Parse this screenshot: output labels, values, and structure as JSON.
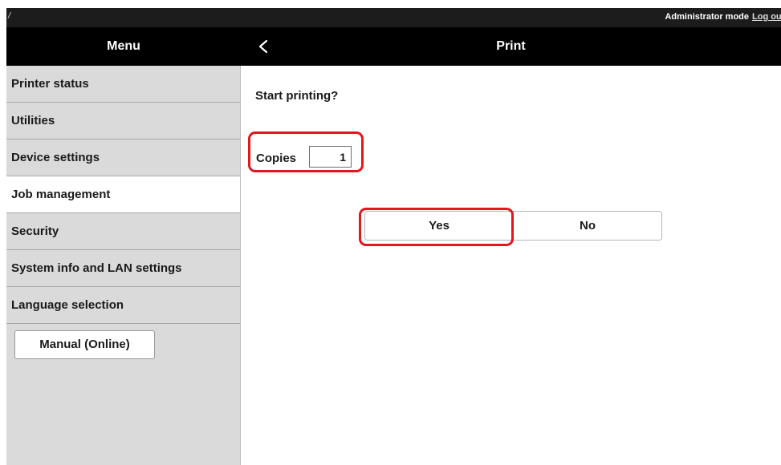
{
  "topbar": {
    "path": "/",
    "mode": "Administrator mode",
    "logout": "Log out"
  },
  "header": {
    "menu_title": "Menu",
    "back_icon": "chevron-left-icon",
    "page_title": "Print"
  },
  "sidebar": {
    "items": [
      {
        "label": "Printer status",
        "active": false
      },
      {
        "label": "Utilities",
        "active": false
      },
      {
        "label": "Device settings",
        "active": false
      },
      {
        "label": "Job management",
        "active": true
      },
      {
        "label": "Security",
        "active": false
      },
      {
        "label": "System info and LAN settings",
        "active": false
      },
      {
        "label": "Language selection",
        "active": false
      }
    ],
    "manual_button": "Manual (Online)"
  },
  "main": {
    "prompt": "Start printing?",
    "copies_label": "Copies",
    "copies_value": "1",
    "yes_label": "Yes",
    "no_label": "No"
  },
  "colors": {
    "highlight": "#e2161e",
    "header_bg": "#000000",
    "topbar_bg": "#1c1c1c",
    "sidebar_bg": "#dadada",
    "active_item_bg": "#ffffff"
  }
}
